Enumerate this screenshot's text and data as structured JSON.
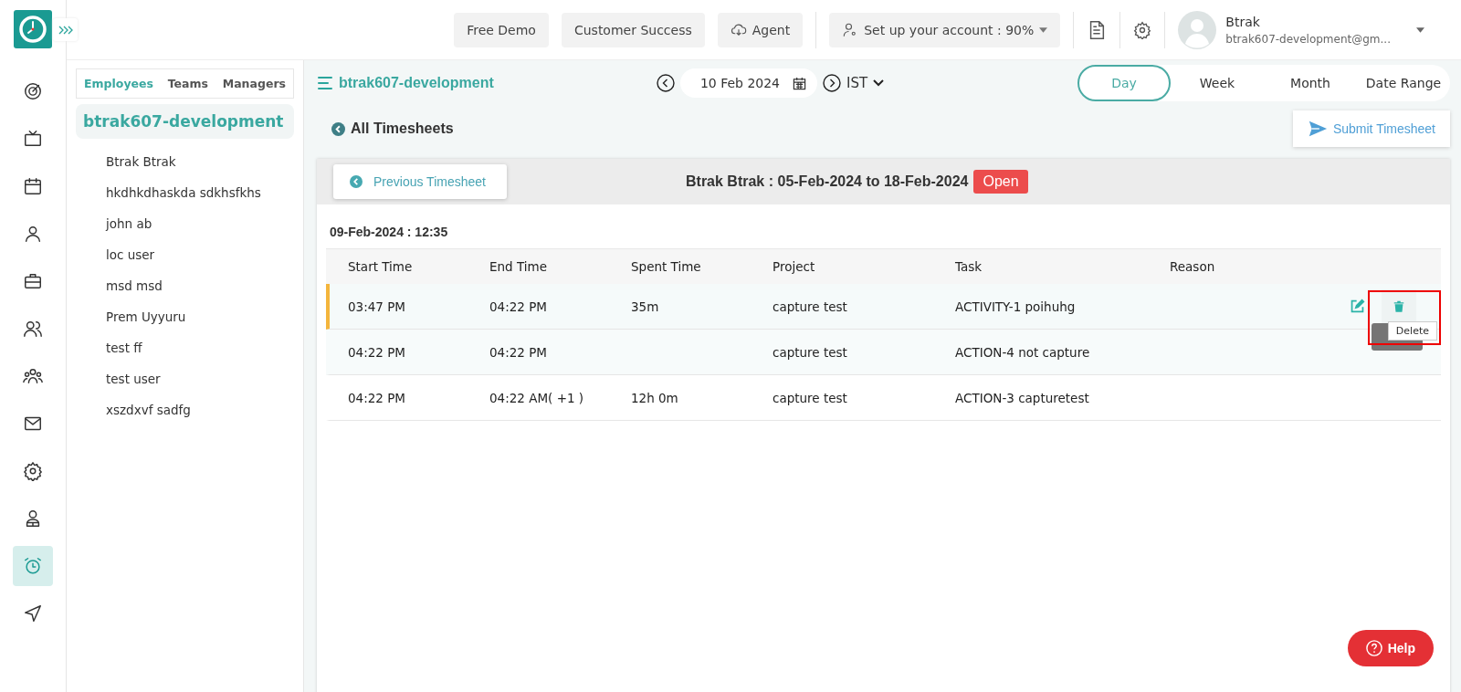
{
  "header": {
    "buttons": [
      "Free Demo",
      "Customer Success",
      "Agent"
    ],
    "setup": "Set up your account : 90%",
    "user": {
      "name": "Btrak",
      "email": "btrak607-development@gm..."
    }
  },
  "rail": [
    {
      "selected": false
    },
    {
      "selected": false
    },
    {
      "selected": false
    },
    {
      "selected": false
    },
    {
      "selected": false
    },
    {
      "selected": false
    },
    {
      "selected": false
    },
    {
      "selected": false
    },
    {
      "selected": false
    },
    {
      "selected": false
    },
    {
      "selected": true
    },
    {
      "selected": false
    }
  ],
  "people_panel": {
    "tabs": [
      {
        "label": "Employees",
        "selected": true
      },
      {
        "label": "Teams",
        "selected": false
      },
      {
        "label": "Managers",
        "selected": false
      }
    ],
    "group": "btrak607-development",
    "people": [
      "Btrak Btrak",
      "hkdhkdhaskda sdkhsfkhs",
      "john ab",
      "loc user",
      "msd msd",
      "Prem Uyyuru",
      "test ff",
      "test user",
      "xszdxvf sadfg"
    ]
  },
  "toolbar": {
    "company": "btrak607-development",
    "date": "10 Feb 2024",
    "timezone": "IST",
    "views": [
      {
        "label": "Day",
        "selected": true
      },
      {
        "label": "Week",
        "selected": false
      },
      {
        "label": "Month",
        "selected": false
      },
      {
        "label": "Date Range",
        "selected": false
      }
    ]
  },
  "back_link": "All Timesheets",
  "submit_button": "Submit Timesheet",
  "timesheet": {
    "previous_button": "Previous Timesheet",
    "title": "Btrak Btrak : 05-Feb-2024 to 18-Feb-2024",
    "status": "Open",
    "day": "09-Feb-2024 : 12:35",
    "columns": [
      "Start Time",
      "End Time",
      "Spent Time",
      "Project",
      "Task",
      "Reason"
    ],
    "rows": [
      {
        "cells": [
          "03:47 PM",
          "04:22 PM",
          "35m",
          "capture test",
          "ACTIVITY-1 poihuhg",
          ""
        ],
        "selected": true
      },
      {
        "cells": [
          "04:22 PM",
          "04:22 PM",
          "",
          "capture test",
          "ACTION-4 not capture",
          ""
        ],
        "selected": false
      },
      {
        "cells": [
          "04:22 PM",
          "04:22 AM( +1 )",
          "12h 0m",
          "capture test",
          "ACTION-3 capturetest",
          ""
        ],
        "selected": false
      }
    ],
    "tooltip": "Delete"
  },
  "help_button": "Help"
}
